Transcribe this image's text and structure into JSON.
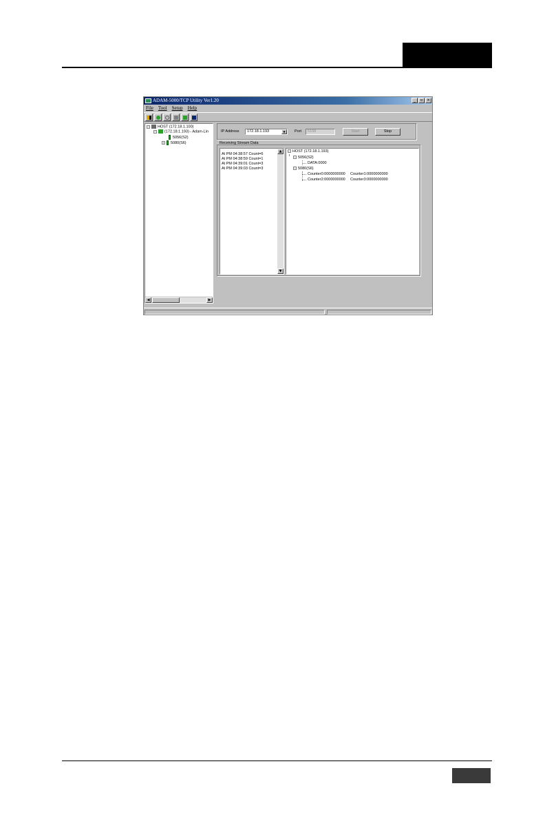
{
  "window": {
    "title": "ADAM-5000/TCP Utility Ver1.20",
    "minimize": "_",
    "maximize": "▫",
    "close": "×"
  },
  "menu": [
    "File",
    "Tool",
    "Setup",
    "Help"
  ],
  "toolbar_icons": [
    "exit-icon",
    "search-network-icon",
    "find-icon",
    "monitor-icon",
    "stream-icon",
    "terminal-icon"
  ],
  "tree": {
    "host": "HOST (172.18.1.100)",
    "device": "(172.18.1.193) - Adam-Lin",
    "modules": [
      "5056(S2)",
      "5080(S6)"
    ]
  },
  "settings": {
    "ip_label": "IP Address",
    "ip_value": "172.18.1.193",
    "port_label": "Port",
    "port_value": "5168",
    "start_label": "Start",
    "stop_label": "Stop"
  },
  "stream": {
    "label": "Receiving Stream Data",
    "log": [
      "At PM 04:38:57 Count=6",
      "At PM 04:38:59 Count=1",
      "At PM 04:39:01 Count=3",
      "At PM 04:39:03 Count=3"
    ],
    "data_tree": {
      "host": "HOST (172.18.1.193)",
      "module1": "5056(S2)",
      "module1_data": "DATA:0000",
      "module2": "5080(S6)",
      "counter0": "Counter0:0000000000",
      "counter1": "Counter1:0000000000",
      "counter2": "Counter2:0000000000",
      "counter3": "Counter3:0000000000"
    }
  }
}
